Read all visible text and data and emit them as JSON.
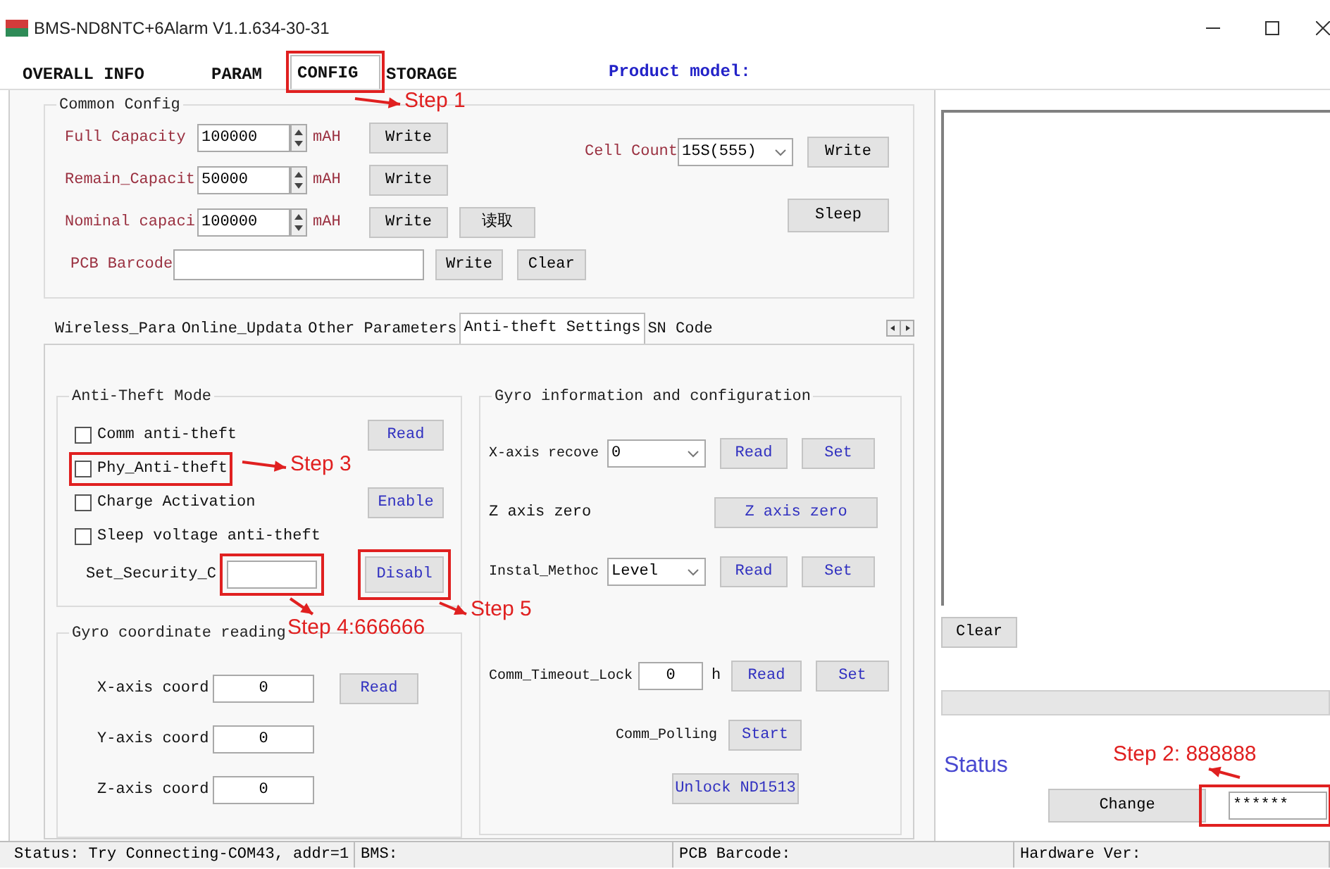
{
  "window": {
    "title": "BMS-ND8NTC+6Alarm V1.1.634-30-31"
  },
  "tabs": [
    {
      "label": "OVERALL INFO",
      "selected": false
    },
    {
      "label": "PARAM",
      "selected": false
    },
    {
      "label": "CONFIG",
      "selected": true
    },
    {
      "label": "STORAGE",
      "selected": false
    }
  ],
  "product_model_label": "Product model:",
  "common_config": {
    "title": "Common Config",
    "capacity_rows": [
      {
        "label": "Full Capacity",
        "value": "100000",
        "unit": "mAH",
        "button": "Write"
      },
      {
        "label": "Remain_Capacit",
        "value": "50000",
        "unit": "mAH",
        "button": "Write"
      },
      {
        "label": "Nominal capaci",
        "value": "100000",
        "unit": "mAH",
        "button": "Write",
        "extra_button": "读取"
      }
    ],
    "pcb_barcode": {
      "label": "PCB Barcode",
      "buttons": [
        "Write",
        "Clear"
      ]
    },
    "cell_count": {
      "label": "Cell Count",
      "value": "15S(555)",
      "button": "Write"
    },
    "sleep_button": "Sleep"
  },
  "sub_tabs": [
    {
      "label": "Wireless_Para",
      "selected": false
    },
    {
      "label": "Online_Updata",
      "selected": false
    },
    {
      "label": "Other Parameters",
      "selected": false
    },
    {
      "label": "Anti-theft Settings",
      "selected": true
    },
    {
      "label": "SN Code",
      "selected": false
    }
  ],
  "anti_theft_mode": {
    "title": "Anti-Theft Mode",
    "options": [
      {
        "label": "Comm anti-theft",
        "checked": false
      },
      {
        "label": "Phy_Anti-theft",
        "checked": false
      },
      {
        "label": "Charge Activation",
        "checked": false
      },
      {
        "label": "Sleep voltage anti-theft",
        "checked": false
      }
    ],
    "buttons": [
      "Read",
      "Enable",
      "Disabl"
    ],
    "security_code_label": "Set_Security_C"
  },
  "gyro_coordinates": {
    "title": "Gyro coordinate reading",
    "rows": [
      {
        "label": "X-axis coord",
        "value": "0"
      },
      {
        "label": "Y-axis coord",
        "value": "0"
      },
      {
        "label": "Z-axis coord",
        "value": "0"
      }
    ],
    "button": "Read"
  },
  "gyro_config": {
    "title": "Gyro information and configuration",
    "x_axis": {
      "label": "X-axis recove",
      "value": "0",
      "buttons": [
        "Read",
        "Set"
      ]
    },
    "z_axis": {
      "label": "Z axis zero",
      "button": "Z axis zero"
    },
    "install": {
      "label": "Instal_Methoc",
      "value": "Level",
      "buttons": [
        "Read",
        "Set"
      ]
    },
    "comm_timeout": {
      "label": "Comm_Timeout_Lock",
      "value": "0",
      "unit": "h",
      "buttons": [
        "Read",
        "Set"
      ]
    },
    "comm_polling": {
      "label": "Comm_Polling",
      "button": "Start"
    },
    "unlock_button": "Unlock ND1513"
  },
  "log_panel": {
    "clear_button": "Clear"
  },
  "status_label": "Status",
  "change_button": "Change",
  "password": {
    "value": "******"
  },
  "status_bar": [
    "Status: Try Connecting-COM43, addr=1",
    "BMS:",
    "PCB Barcode:",
    "Hardware Ver:"
  ],
  "annotations": [
    {
      "text": "Step 1"
    },
    {
      "text": "Step 2: 888888"
    },
    {
      "text": "Step 3"
    },
    {
      "text": "Step 4:666666"
    },
    {
      "text": "Step 5"
    }
  ]
}
